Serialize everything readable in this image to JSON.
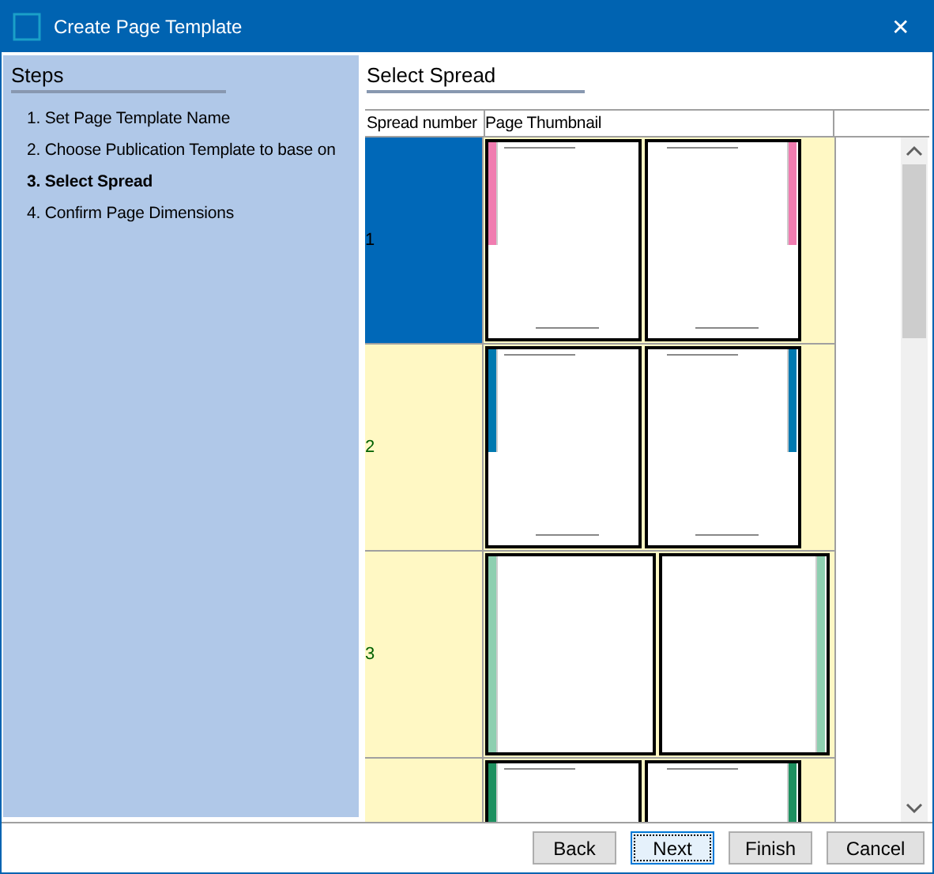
{
  "window": {
    "title": "Create Page Template",
    "close": "✕"
  },
  "steps": {
    "title": "Steps",
    "items": [
      {
        "label": "1. Set Page Template Name",
        "selected": false
      },
      {
        "label": "2. Choose Publication Template to base on",
        "selected": false
      },
      {
        "label": "3. Select Spread",
        "selected": true
      },
      {
        "label": "4. Confirm Page Dimensions",
        "selected": false
      }
    ]
  },
  "content": {
    "title": "Select Spread",
    "columns": [
      "Spread number",
      "Page Thumbnail"
    ],
    "rows": [
      {
        "number": "1",
        "selected": true,
        "kind": "partial",
        "color": "#f07cb0",
        "wide": false
      },
      {
        "number": "2",
        "selected": false,
        "kind": "partial",
        "color": "#0079b0",
        "wide": false
      },
      {
        "number": "3",
        "selected": false,
        "kind": "full",
        "color": "#8ecfb0",
        "wide": true
      },
      {
        "selected": false,
        "kind": "partial",
        "color": "#1e9060",
        "wide": false
      }
    ]
  },
  "buttons": [
    {
      "label": "Back",
      "focused": false
    },
    {
      "label": "Next",
      "focused": true
    },
    {
      "label": "Finish",
      "focused": false
    },
    {
      "label": "Cancel",
      "focused": false
    }
  ]
}
